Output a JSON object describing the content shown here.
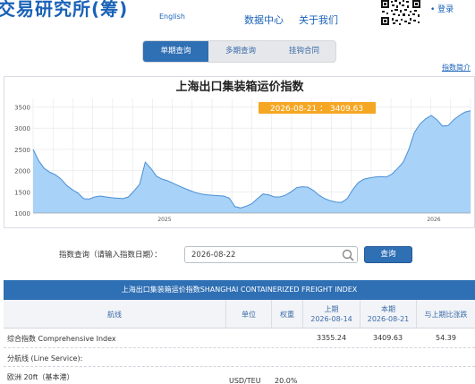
{
  "header": {
    "logo_text": "交易研究所(筹)",
    "english_link": "English",
    "nav": [
      "数据中心",
      "关于我们"
    ],
    "login": "• 登录",
    "qr_icon": "qr-code"
  },
  "tabs": [
    {
      "label": "单期查询",
      "active": true
    },
    {
      "label": "多期查询",
      "active": false
    },
    {
      "label": "挂钩合同",
      "active": false
    }
  ],
  "index_desc_link": "指数简介",
  "chart_data": {
    "type": "area",
    "title": "上海出口集装箱运价指数",
    "tooltip": "2026-08-21 ： 3409.63",
    "y_ticks": [
      "3500",
      "3000",
      "2500",
      "2000",
      "1500",
      "1000"
    ],
    "x_ticks": [
      "2025",
      "2026"
    ],
    "ylim": [
      1000,
      3700
    ],
    "fill_color": "#a8d2f7",
    "line_color": "#4a8fd6",
    "tooltip_color": "#f5a623",
    "values": [
      2500,
      2230,
      2050,
      1960,
      1900,
      1800,
      1650,
      1550,
      1470,
      1340,
      1330,
      1380,
      1400,
      1380,
      1360,
      1350,
      1340,
      1380,
      1520,
      1680,
      2200,
      2050,
      1870,
      1800,
      1760,
      1700,
      1640,
      1580,
      1530,
      1480,
      1450,
      1430,
      1420,
      1410,
      1400,
      1350,
      1150,
      1120,
      1160,
      1220,
      1340,
      1450,
      1430,
      1380,
      1380,
      1420,
      1500,
      1600,
      1620,
      1610,
      1530,
      1420,
      1340,
      1290,
      1260,
      1250,
      1340,
      1550,
      1720,
      1800,
      1830,
      1850,
      1860,
      1850,
      1920,
      2050,
      2200,
      2500,
      2900,
      3100,
      3220,
      3300,
      3200,
      3050,
      3060,
      3200,
      3300,
      3380,
      3409.63
    ]
  },
  "query": {
    "label": "指数查询（请输入指数日期）：",
    "date_value": "2026-08-22",
    "button": "查询"
  },
  "table": {
    "title": "上海出口集装箱运价指数SHANGHAI CONTAINERIZED FREIGHT INDEX",
    "headers": {
      "route": "航线",
      "unit": "单位",
      "weight": "权重",
      "prev_label": "上期",
      "prev_date": "2026-08-14",
      "curr_label": "本期",
      "curr_date": "2026-08-21",
      "change": "与上期比涨跌"
    },
    "rows": [
      {
        "route": "综合指数 Comprehensive Index",
        "unit": "",
        "weight": "",
        "prev": "3355.24",
        "curr": "3409.63",
        "change": "54.39"
      },
      {
        "route": "分航线 (Line Service):"
      },
      {
        "route": "欧洲 20ft（基本港）",
        "unit": "USD/TEU",
        "weight": "20.0%",
        "prev": "",
        "curr": "",
        "change": ""
      }
    ]
  }
}
